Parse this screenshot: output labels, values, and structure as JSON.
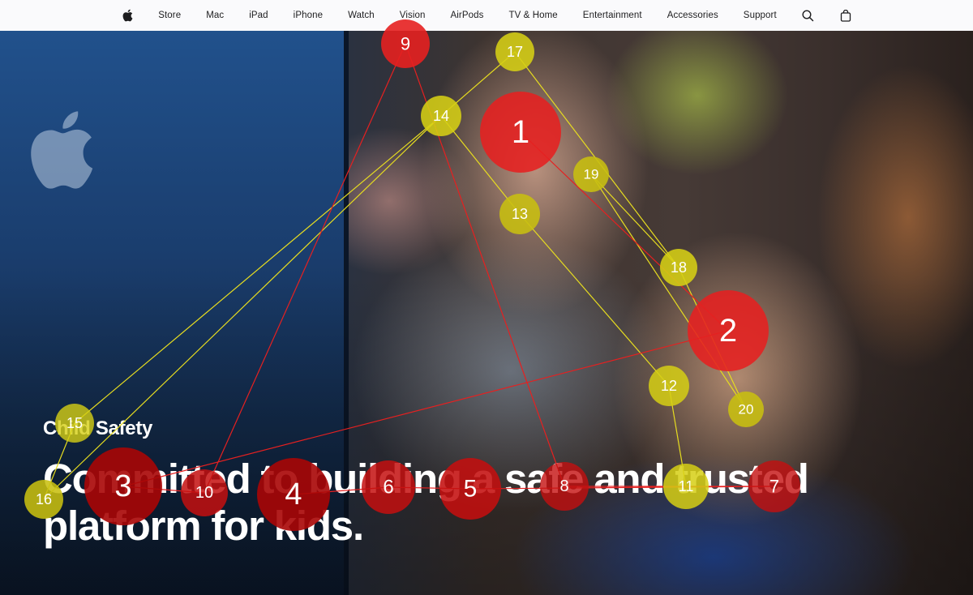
{
  "nav": {
    "items": [
      "Store",
      "Mac",
      "iPad",
      "iPhone",
      "Watch",
      "Vision",
      "AirPods",
      "TV & Home",
      "Entertainment",
      "Accessories",
      "Support"
    ],
    "icons": {
      "logo": "apple-logo-icon",
      "search": "search-icon",
      "bag": "bag-icon"
    }
  },
  "hero": {
    "eyebrow": "Child Safety",
    "headline_line1": "Committed to building a safe and trusted",
    "headline_line2": "platform for kids."
  },
  "colors": {
    "red": "#e62020",
    "yellow": "#d6cf14",
    "dark_red": "#a80505",
    "nav_bg": "#fafafc"
  },
  "gaze": {
    "red_labels": [
      "1",
      "2",
      "3",
      "4",
      "5",
      "6",
      "7",
      "8",
      "9",
      "10"
    ],
    "yellow_labels": [
      "11",
      "12",
      "13",
      "14",
      "15",
      "16",
      "17",
      "18",
      "19",
      "20"
    ]
  }
}
